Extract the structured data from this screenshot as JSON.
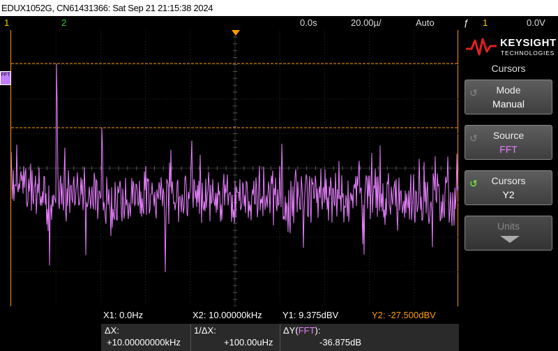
{
  "titlebar": {
    "text": "EDUX1052G, CN61431366: Sat Sep 21 21:15:38 2024"
  },
  "status": {
    "ch1": "1",
    "ch2": "2",
    "time_delay": "0.0s",
    "time_scale": "20.00µ/",
    "trigger_mode": "Auto",
    "trigger_icon": "ƒ",
    "trigger_ch": "1",
    "trigger_level": "0.0V"
  },
  "fft_marker": "FFT",
  "panel": {
    "brand": "KEYSIGHT",
    "brand_sub": "TECHNOLOGIES",
    "menu_title": "Cursors",
    "softkeys": [
      {
        "label": "Mode",
        "value": "Manual"
      },
      {
        "label": "Source",
        "value": "FFT"
      },
      {
        "label": "Cursors",
        "value": "Y2"
      },
      {
        "label": "Units",
        "value": ""
      }
    ]
  },
  "readout": {
    "x1": "X1:  0.0Hz",
    "x2": "X2:  10.00000kHz",
    "y1": "Y1:  9.375dBV",
    "y2": "Y2: -27.500dBV",
    "dx_label": "ΔX:",
    "dx_value": "+10.00000000kHz",
    "inv_dx_label": "1/ΔX:",
    "inv_dx_value": "+100.00uHz",
    "dy_label": "ΔY(",
    "dy_src": "FFT",
    "dy_close": "):",
    "dy_value": "-36.875dB"
  },
  "colors": {
    "fft": "#e880ff",
    "cursor": "#ff9b00",
    "ch1": "#f5d000",
    "ch2": "#32c832"
  }
}
